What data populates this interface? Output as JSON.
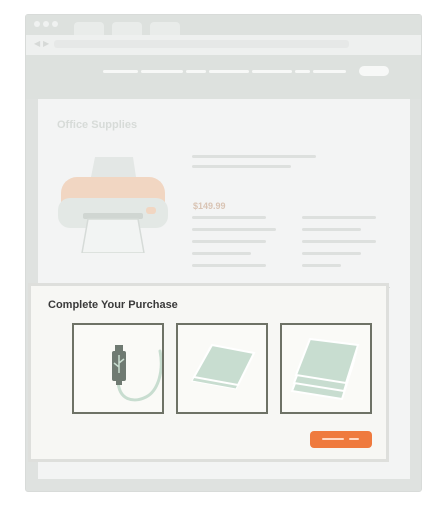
{
  "page": {
    "section_title": "Office Supplies",
    "product": {
      "price": "$149.99",
      "image_icon": "printer-icon"
    },
    "purchase": {
      "title": "Complete Your Purchase",
      "options": [
        {
          "icon": "usb-cable-icon"
        },
        {
          "icon": "paper-sheets-icon"
        },
        {
          "icon": "paper-stack-icon"
        }
      ]
    }
  },
  "colors": {
    "accent_orange": "#ef7a3e",
    "icon_green": "#c8ddd0",
    "option_border": "#6e7266",
    "usb_dark": "#6f7a72"
  }
}
